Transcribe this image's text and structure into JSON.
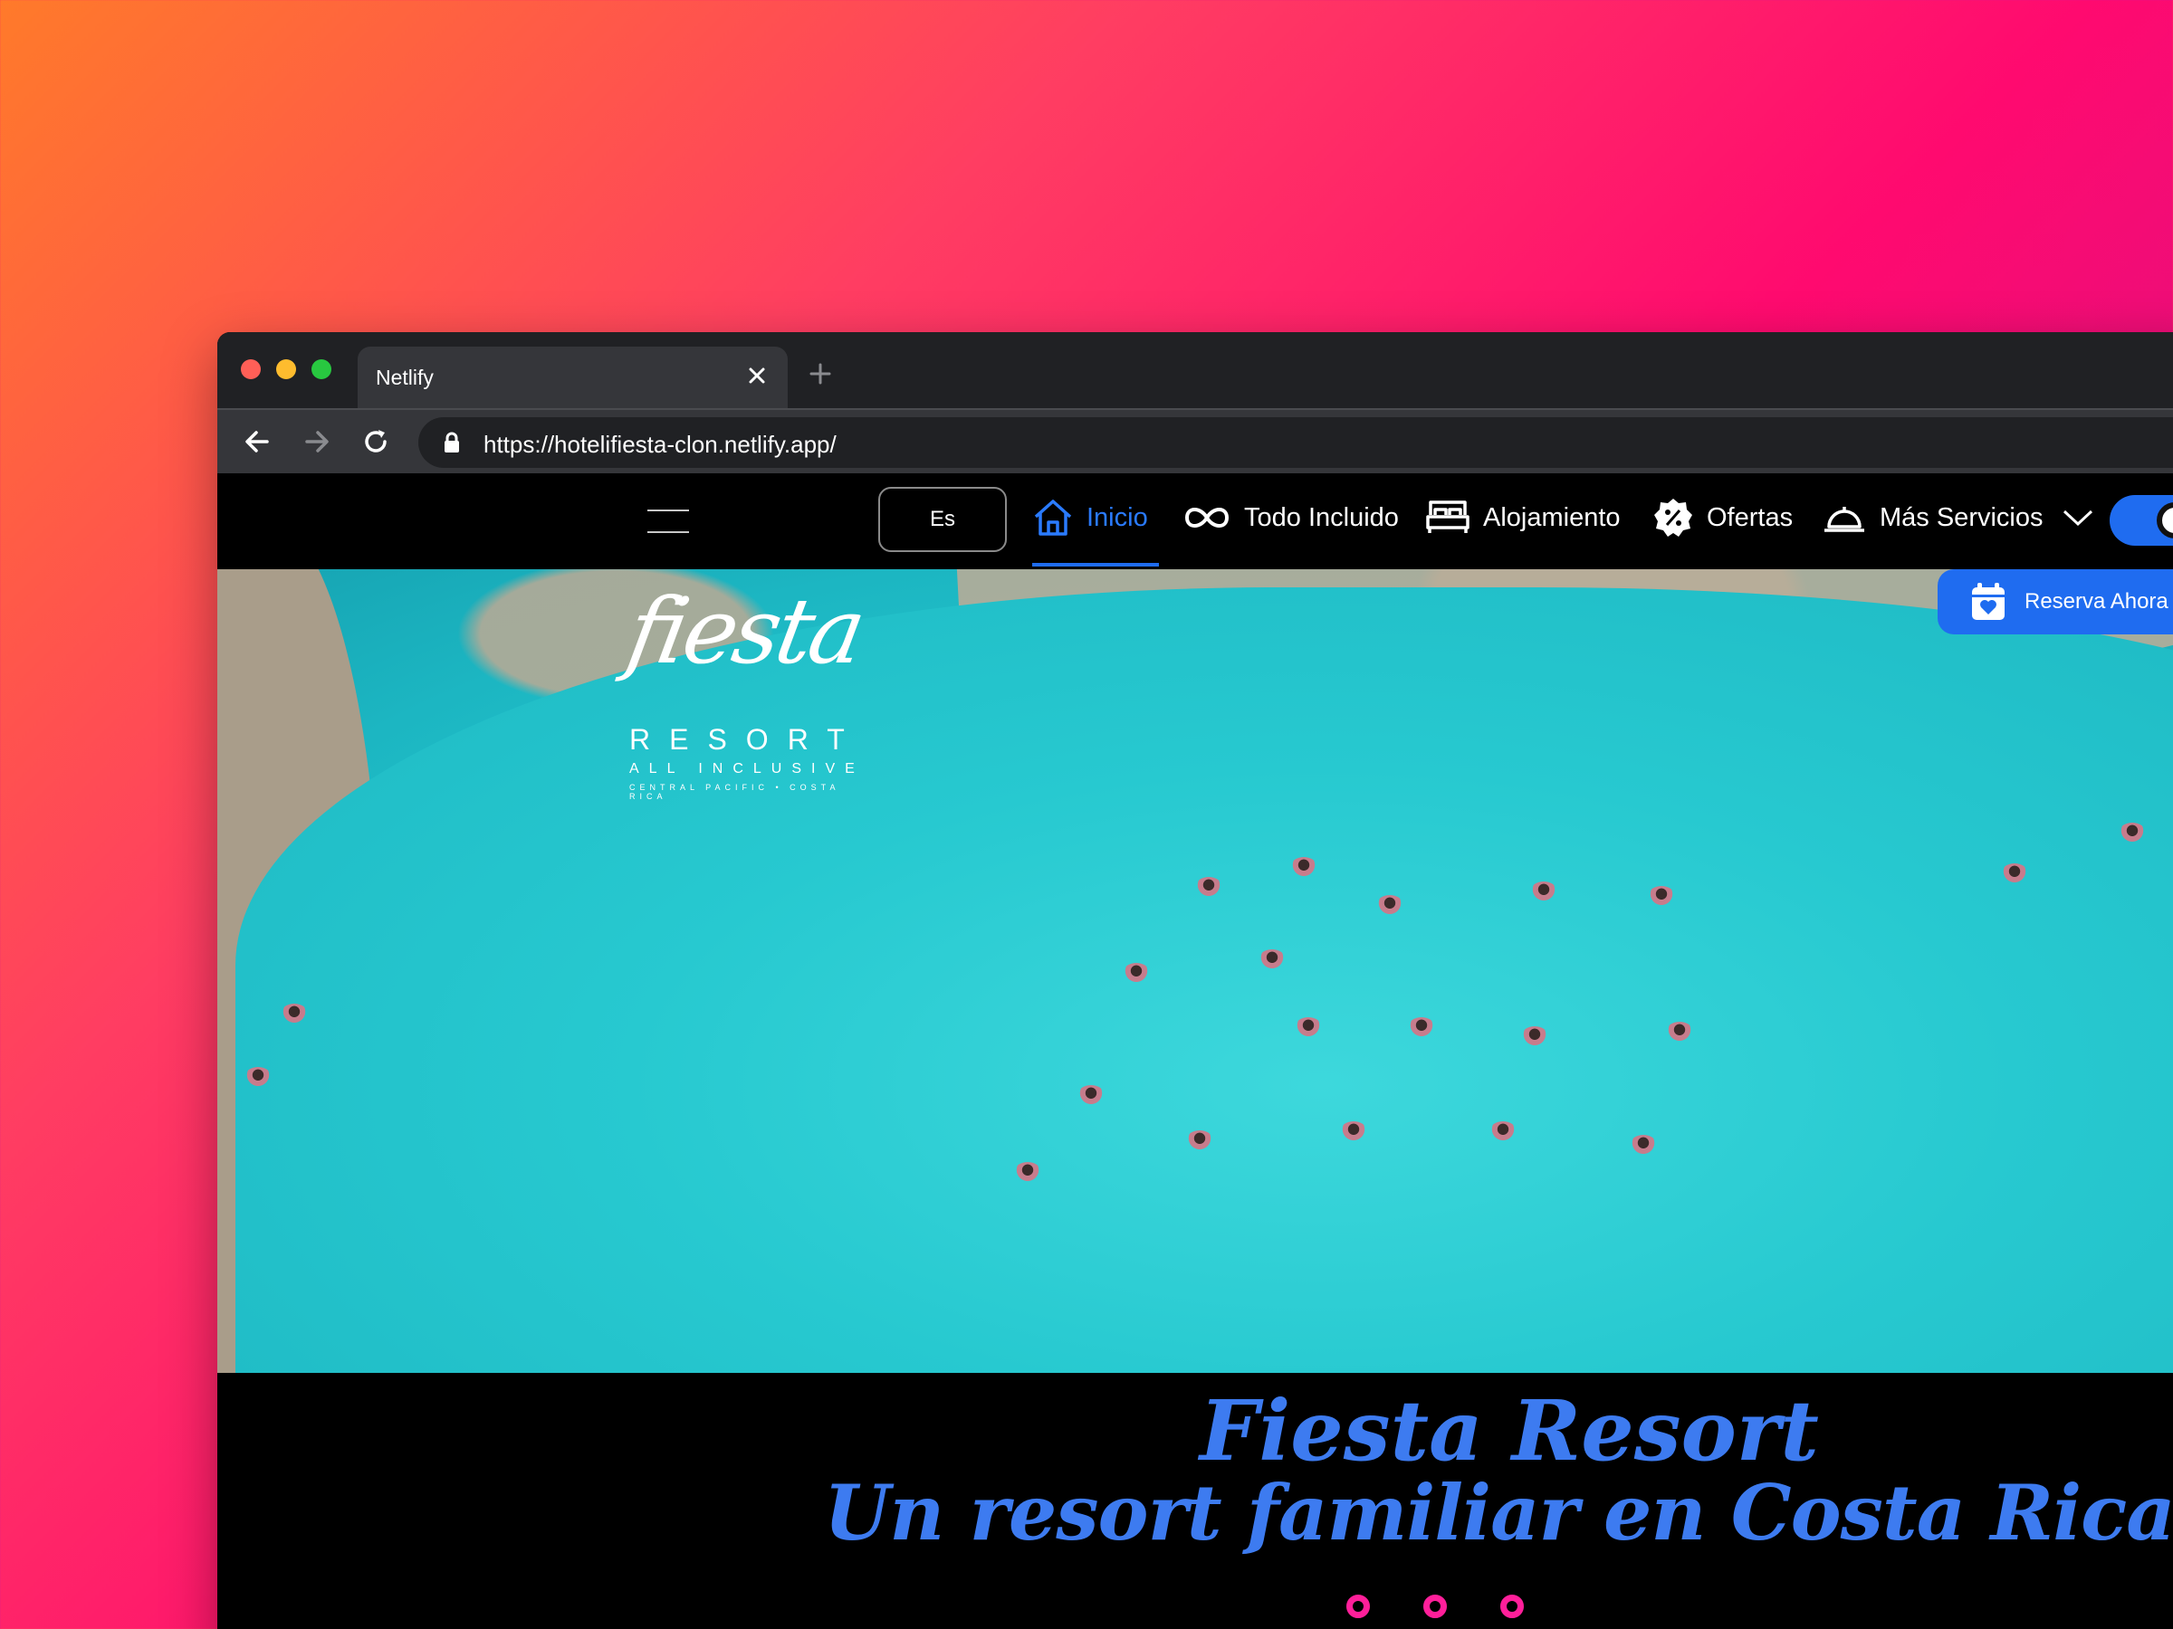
{
  "browser": {
    "tab_title": "Netlify",
    "url": "https://hotelifiesta-clon.netlify.app/"
  },
  "nav": {
    "lang": "Es",
    "items": [
      {
        "label": "Inicio",
        "icon": "home-icon"
      },
      {
        "label": "Todo Incluido",
        "icon": "infinity-icon"
      },
      {
        "label": "Alojamiento",
        "icon": "bed-icon"
      },
      {
        "label": "Ofertas",
        "icon": "discount-badge-icon"
      },
      {
        "label": "Más Servicios",
        "icon": "service-bell-icon"
      }
    ],
    "active_index": 0
  },
  "hero": {
    "logo": {
      "script": "fiesta",
      "resort": "RESORT",
      "all_inclusive": "ALL INCLUSIVE",
      "location": "CENTRAL PACIFIC • COSTA RICA"
    },
    "reserva_label": "Reserva Ahora"
  },
  "headline": {
    "line1": "Fiesta Resort",
    "line2": "Un resort familiar en Costa Rica"
  },
  "colors": {
    "accent": "#1f6cf0",
    "headline": "#3d7bf0",
    "dots": "#ff1f9a",
    "pool": "#27c9d0"
  }
}
